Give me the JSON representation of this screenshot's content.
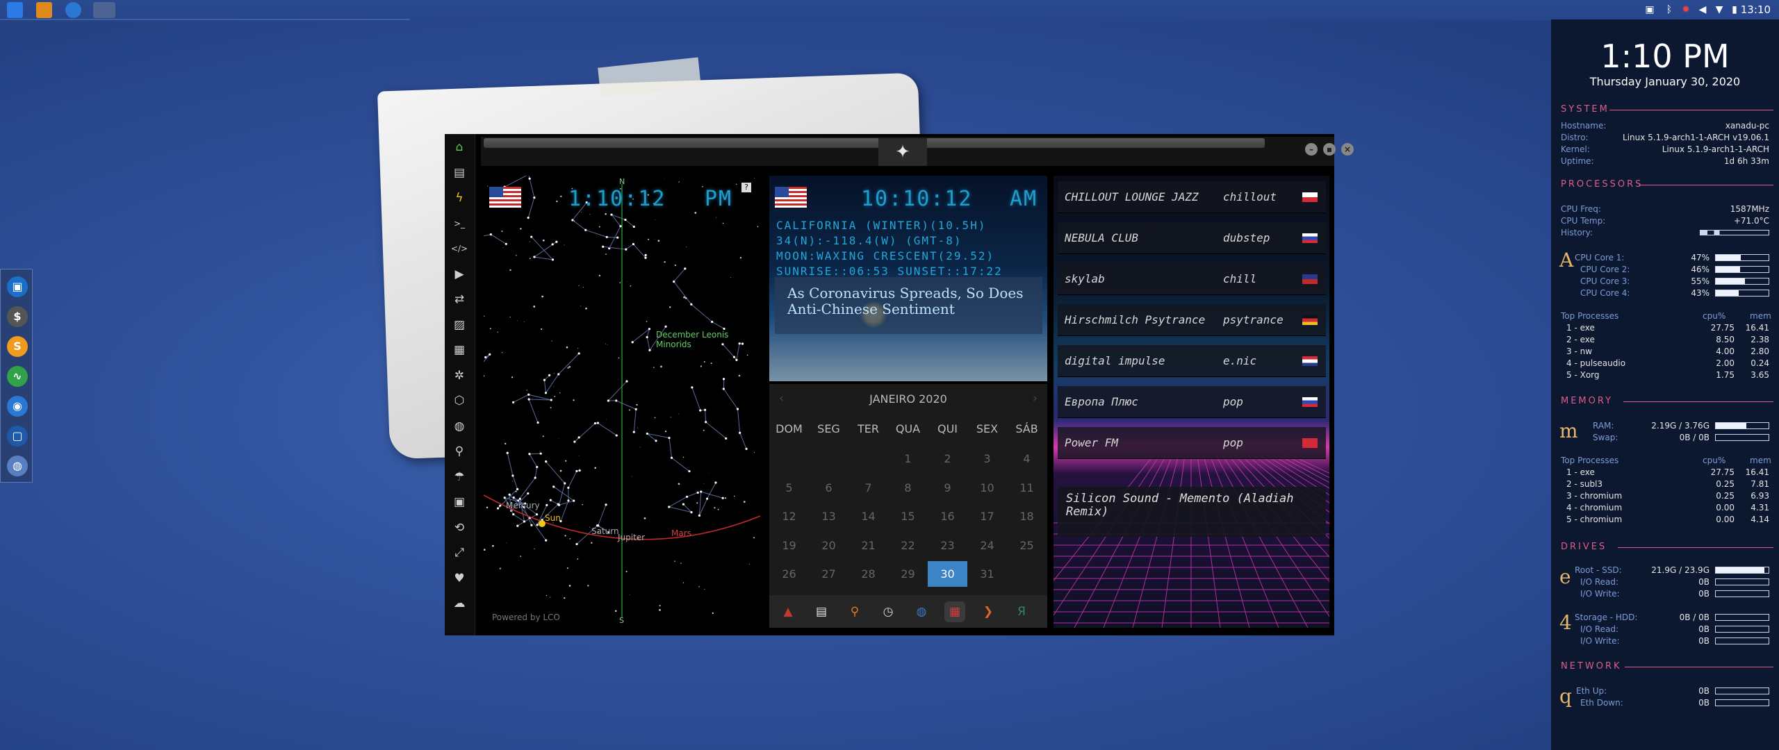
{
  "top_panel": {
    "clock": "13:10",
    "apps": [
      "file-manager-icon",
      "sublime-icon",
      "chromium-icon",
      "desktop-switcher-icon"
    ]
  },
  "left_dock": {
    "items": [
      {
        "name": "file-manager-icon",
        "color": "#1b6fc8",
        "glyph": "▣"
      },
      {
        "name": "money-icon",
        "color": "#555555",
        "glyph": "$"
      },
      {
        "name": "sublime-icon",
        "color": "#f09a1e",
        "glyph": "S"
      },
      {
        "name": "activity-icon",
        "color": "#2fa24a",
        "glyph": "∿"
      },
      {
        "name": "chromium-icon",
        "color": "#2a78d3",
        "glyph": "◉"
      },
      {
        "name": "screenshot-icon",
        "color": "#1e5aa8",
        "glyph": "▢"
      },
      {
        "name": "globe-icon",
        "color": "#5a7fc0",
        "glyph": "◍"
      }
    ]
  },
  "app": {
    "sidebar_icons": [
      "home-icon",
      "document-icon",
      "lightning-icon",
      "terminal-icon",
      "code-icon",
      "play-icon",
      "translate-icon",
      "image-icon",
      "news-icon",
      "settings-icon",
      "hexagon-icon",
      "globe-icon",
      "search-icon",
      "umbrella-icon",
      "contact-icon",
      "link-icon",
      "expand-icon",
      "heart-icon",
      "cloud-icon"
    ]
  },
  "starmap": {
    "time": "1:10:12",
    "ampm": "PM",
    "help": "?",
    "north": "N",
    "south": "S",
    "labels": {
      "december": "December Leonis Minorids",
      "mercury": "Mercury",
      "sun": "Sun",
      "saturn": "Saturn",
      "jupiter": "Jupiter",
      "mars": "Mars"
    },
    "footer": "Powered by LCO"
  },
  "weather": {
    "time": "10:10:12",
    "ampm": "AM",
    "line1": "CALIFORNIA (WINTER)(10.5H)",
    "line2": "34(N):-118.4(W) (GMT-8)",
    "line3": "MOON:WAXING CRESCENT(29.52)",
    "line4": "SUNRISE::06:53 SUNSET::17:22",
    "news": "As Coronavirus Spreads, So Does Anti-Chinese Sentiment"
  },
  "calendar": {
    "title": "JANEIRO 2020",
    "prev": "‹",
    "next": "›",
    "headers": [
      "DOM",
      "SEG",
      "TER",
      "QUA",
      "QUI",
      "SEX",
      "SÁB"
    ],
    "today": "30",
    "weeks": [
      [
        "",
        "",
        "",
        "1",
        "2",
        "3",
        "4"
      ],
      [
        "5",
        "6",
        "7",
        "8",
        "9",
        "10",
        "11"
      ],
      [
        "12",
        "13",
        "14",
        "15",
        "16",
        "17",
        "18"
      ],
      [
        "19",
        "20",
        "21",
        "22",
        "23",
        "24",
        "25"
      ],
      [
        "26",
        "27",
        "28",
        "29",
        "30",
        "31",
        ""
      ]
    ]
  },
  "mini_dock": [
    {
      "name": "alert-icon",
      "color": "#c0392b",
      "glyph": "▲"
    },
    {
      "name": "calendar-icon",
      "color": "#e8e8e8",
      "glyph": "▤"
    },
    {
      "name": "search-icon",
      "color": "#e07a1f",
      "glyph": "⚲"
    },
    {
      "name": "clock-icon",
      "color": "#d9d9d9",
      "glyph": "◷"
    },
    {
      "name": "globe-icon",
      "color": "#3b7ac2",
      "glyph": "◍"
    },
    {
      "name": "calendar-app-icon",
      "color": "#d73c3c",
      "glyph": "▦"
    },
    {
      "name": "arrow-icon",
      "color": "#e0671f",
      "glyph": "❯"
    },
    {
      "name": "translate-icon",
      "color": "#2e8a5c",
      "glyph": "Я"
    }
  ],
  "radio": {
    "stations": [
      {
        "name": "CHILLOUT LOUNGE JAZZ",
        "genre": "chillout",
        "flag": "pl"
      },
      {
        "name": "NEBULA CLUB",
        "genre": "dubstep",
        "flag": "ru"
      },
      {
        "name": "skylab",
        "genre": "chill",
        "flag": "gb"
      },
      {
        "name": "Hirschmilch Psytrance",
        "genre": "psytrance",
        "flag": "de"
      },
      {
        "name": "digital impulse",
        "genre": "e.nic",
        "flag": "hr"
      },
      {
        "name": "Европа Плюс",
        "genre": "pop",
        "flag": "ru"
      },
      {
        "name": "Power FM",
        "genre": "pop",
        "flag": "tr"
      }
    ],
    "now_playing": "Silicon Sound - Memento (Aladiah Remix)"
  },
  "conky": {
    "time": "1:10 PM",
    "date": "Thursday January 30, 2020",
    "system": {
      "head": "SYSTEM",
      "rows": [
        [
          "Hostname:",
          "xanadu-pc"
        ],
        [
          "Distro:",
          "Linux 5.1.9-arch1-1-ARCH v19.06.1"
        ],
        [
          "Kernel:",
          "Linux 5.1.9-arch1-1-ARCH"
        ],
        [
          "Uptime:",
          "1d 6h 33m"
        ]
      ]
    },
    "processors": {
      "head": "PROCESSORS",
      "freq_label": "CPU Freq:",
      "freq": "1587MHz",
      "temp_label": "CPU Temp:",
      "temp": "+71.0°C",
      "history_label": "History:",
      "letter": "A",
      "cores": [
        [
          "CPU Core 1:",
          "47%",
          0.47
        ],
        [
          "CPU Core 2:",
          "46%",
          0.46
        ],
        [
          "CPU Core 3:",
          "55%",
          0.55
        ],
        [
          "CPU Core 4:",
          "43%",
          0.43
        ]
      ],
      "top_label": "Top Processes",
      "cpu_label": "cpu%",
      "mem_label": "mem",
      "procs": [
        [
          "1 - exe",
          "27.75",
          "16.41"
        ],
        [
          "2 - exe",
          "8.50",
          "2.38"
        ],
        [
          "3 - nw",
          "4.00",
          "2.80"
        ],
        [
          "4 - pulseaudio",
          "2.00",
          "0.24"
        ],
        [
          "5 - Xorg",
          "1.75",
          "3.65"
        ]
      ]
    },
    "memory": {
      "head": "MEMORY",
      "letter": "m",
      "ram_label": "RAM:",
      "ram": "2.19G / 3.76G",
      "ram_frac": 0.58,
      "swap_label": "Swap:",
      "swap": "0B / 0B",
      "swap_frac": 0,
      "top_label": "Top Processes",
      "cpu_label": "cpu%",
      "mem_label": "mem",
      "procs": [
        [
          "1 - exe",
          "27.75",
          "16.41"
        ],
        [
          "2 - subl3",
          "0.25",
          "7.81"
        ],
        [
          "3 - chromium",
          "0.25",
          "6.93"
        ],
        [
          "4 - chromium",
          "0.00",
          "4.31"
        ],
        [
          "5 - chromium",
          "0.00",
          "4.14"
        ]
      ]
    },
    "drives": {
      "head": "DRIVES",
      "root_letter": "e",
      "root_label": "Root - SSD:",
      "root": "21.9G / 23.9G",
      "root_frac": 0.92,
      "storage_letter": "4",
      "storage_label": "Storage - HDD:",
      "storage": "0B / 0B",
      "storage_frac": 0,
      "read_label": "I/O Read:",
      "write_label": "I/O Write:",
      "zero": "0B"
    },
    "network": {
      "head": "NETWORK",
      "letter": "q",
      "up_label": "Eth Up:",
      "down_label": "Eth Down:",
      "up": "0B",
      "down": "0B"
    }
  }
}
